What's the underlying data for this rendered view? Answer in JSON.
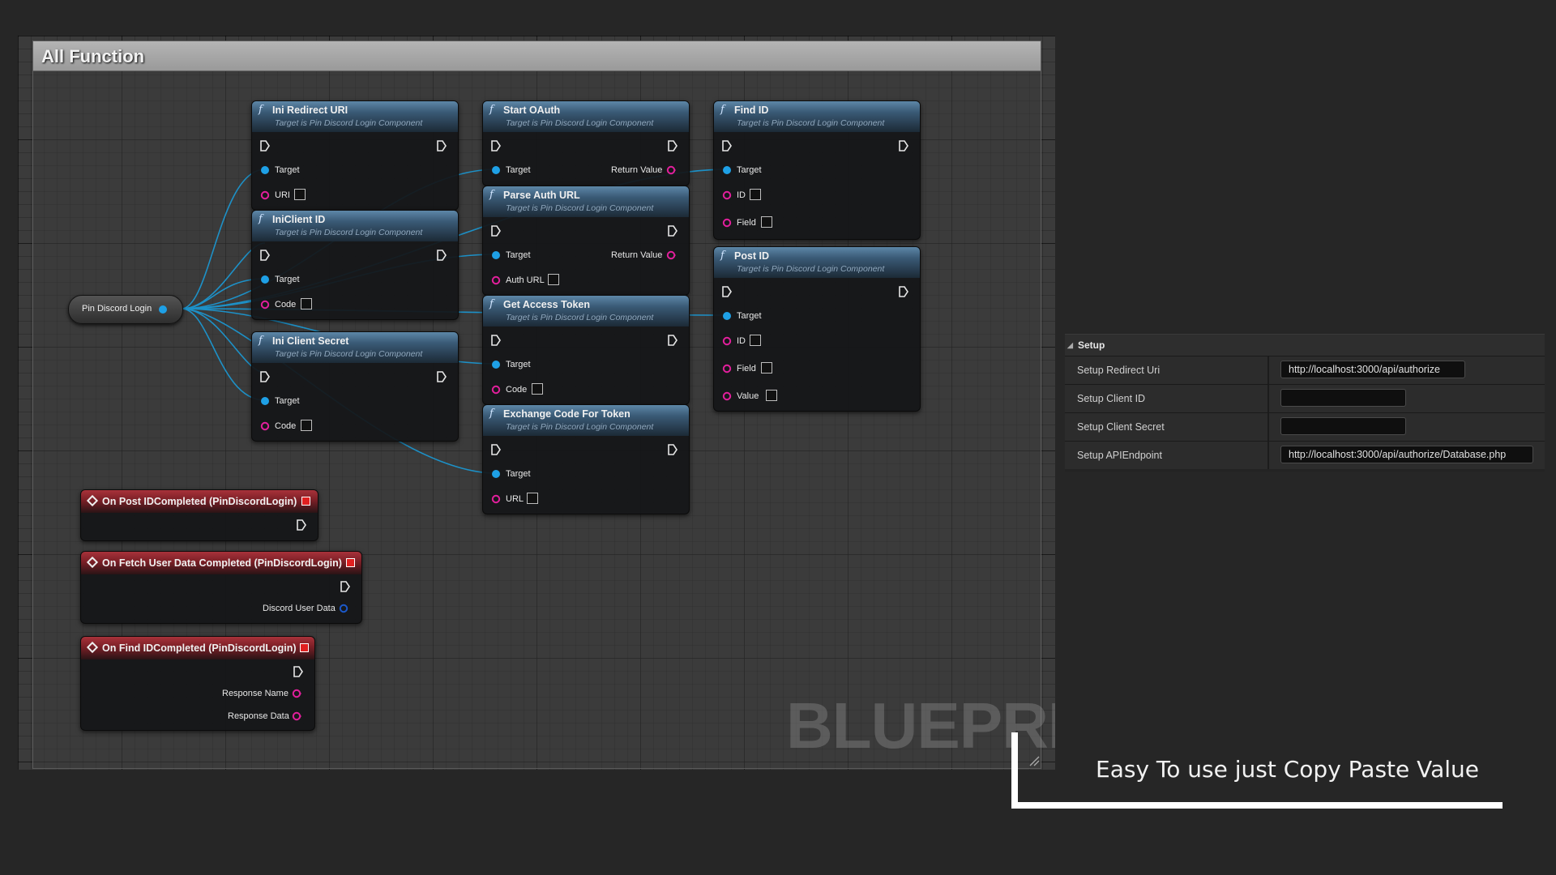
{
  "comment_title": "All Function",
  "watermark": "BLUEPRINT",
  "source_node": {
    "label": "Pin Discord Login"
  },
  "function_nodes": [
    {
      "title": "Ini Redirect URI",
      "subtitle": "Target is Pin Discord Login Component",
      "pins": [
        "Target",
        "URI"
      ]
    },
    {
      "title": "IniClient ID",
      "subtitle": "Target is Pin Discord Login Component",
      "pins": [
        "Target",
        "Code"
      ]
    },
    {
      "title": "Ini Client Secret",
      "subtitle": "Target is Pin Discord Login Component",
      "pins": [
        "Target",
        "Code"
      ]
    },
    {
      "title": "Start OAuth",
      "subtitle": "Target is Pin Discord Login Component",
      "pins": [
        "Target"
      ],
      "output": "Return Value"
    },
    {
      "title": "Parse Auth URL",
      "subtitle": "Target is Pin Discord Login Component",
      "pins": [
        "Target",
        "Auth URL"
      ],
      "output": "Return Value"
    },
    {
      "title": "Get Access Token",
      "subtitle": "Target is Pin Discord Login Component",
      "pins": [
        "Target",
        "Code"
      ]
    },
    {
      "title": "Exchange Code For Token",
      "subtitle": "Target is Pin Discord Login Component",
      "pins": [
        "Target",
        "URL"
      ]
    },
    {
      "title": "Find ID",
      "subtitle": "Target is Pin Discord Login Component",
      "pins": [
        "Target",
        "ID",
        "Field"
      ]
    },
    {
      "title": "Post ID",
      "subtitle": "Target is Pin Discord Login Component",
      "pins": [
        "Target",
        "ID",
        "Field",
        "Value"
      ]
    }
  ],
  "event_nodes": [
    {
      "title": "On Post IDCompleted (PinDiscordLogin)",
      "outputs": []
    },
    {
      "title": "On Fetch User Data Completed (PinDiscordLogin)",
      "outputs": [
        "Discord User Data"
      ]
    },
    {
      "title": "On Find IDCompleted (PinDiscordLogin)",
      "outputs": [
        "Response Name",
        "Response Data"
      ]
    }
  ],
  "details_panel": {
    "section": "Setup",
    "rows": [
      {
        "label": "Setup Redirect Uri",
        "value": "http://localhost:3000/api/authorize"
      },
      {
        "label": "Setup Client ID",
        "value": ""
      },
      {
        "label": "Setup Client Secret",
        "value": ""
      },
      {
        "label": "Setup APIEndpoint",
        "value": "http://localhost:3000/api/authorize/Database.php"
      }
    ]
  },
  "caption": "Easy To use just Copy Paste Value",
  "colors": {
    "exec_pin": "#e6e6e6",
    "object_pin": "#1ea0e6",
    "string_pin": "#e21f9c",
    "struct_pin": "#1b58c9",
    "function_header": "#4c7a9c",
    "event_header": "#a8323a"
  }
}
